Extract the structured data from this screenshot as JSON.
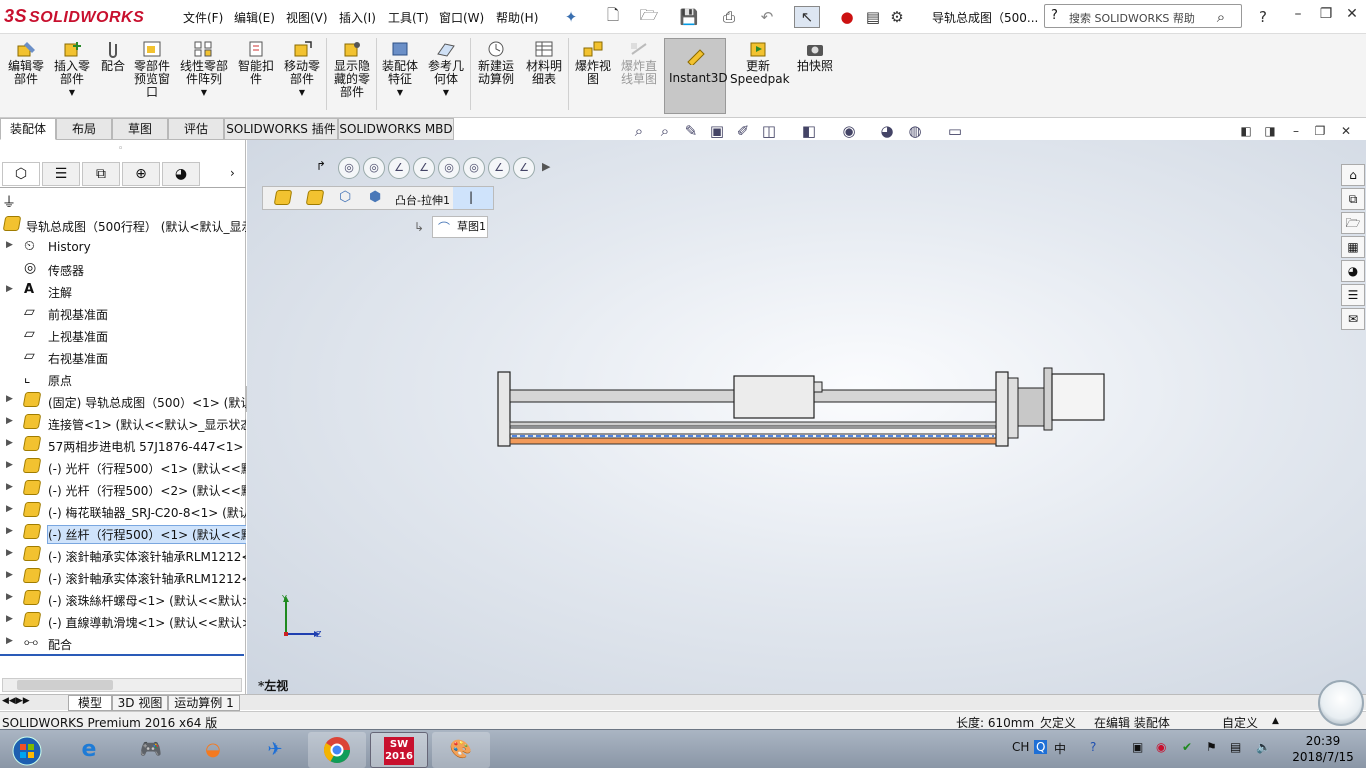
{
  "app": {
    "logo": "SOLIDWORKS",
    "logo_mark": "3S",
    "doc_title": "导轨总成图（500...",
    "search_placeholder": "搜索 SOLIDWORKS 帮助"
  },
  "menus": [
    "文件(F)",
    "编辑(E)",
    "视图(V)",
    "插入(I)",
    "工具(T)",
    "窗口(W)",
    "帮助(H)"
  ],
  "ribbon": {
    "buttons": [
      {
        "label": "编辑零\n部件"
      },
      {
        "label": "插入零\n部件"
      },
      {
        "label": "配合"
      },
      {
        "label": "零部件\n预览窗\n口"
      },
      {
        "label": "线性零部\n件阵列"
      },
      {
        "label": "智能扣\n件"
      },
      {
        "label": "移动零\n部件"
      },
      {
        "label": "显示隐\n藏的零\n部件"
      },
      {
        "label": "装配体\n特征"
      },
      {
        "label": "参考几\n何体"
      },
      {
        "label": "新建运\n动算例"
      },
      {
        "label": "材料明\n细表"
      },
      {
        "label": "爆炸视\n图"
      },
      {
        "label": "爆炸直\n线草图"
      },
      {
        "label": "Instant3D"
      },
      {
        "label": "更新\nSpeedpak"
      },
      {
        "label": "拍快照"
      }
    ]
  },
  "tabs": [
    "装配体",
    "布局",
    "草图",
    "评估",
    "SOLIDWORKS 插件",
    "SOLIDWORKS MBD"
  ],
  "tree": {
    "root": "导轨总成图（500行程）  (默认<默认_显示",
    "items": [
      {
        "label": "History"
      },
      {
        "label": "传感器"
      },
      {
        "label": "注解"
      },
      {
        "label": "前视基准面"
      },
      {
        "label": "上视基准面"
      },
      {
        "label": "右视基准面"
      },
      {
        "label": "原点"
      },
      {
        "label": "(固定) 导轨总成图（500）<1> (默认"
      },
      {
        "label": "连接管<1> (默认<<默认>_显示状态"
      },
      {
        "label": "57两相步进电机 57J1876-447<1> ("
      },
      {
        "label": "(-) 光杆（行程500）<1> (默认<<默"
      },
      {
        "label": "(-) 光杆（行程500）<2> (默认<<默"
      },
      {
        "label": "(-) 梅花联轴器_SRJ-C20-8<1> (默认"
      },
      {
        "label": "(-) 丝杆（行程500）<1> (默认<<默"
      },
      {
        "label": "(-) 滚針軸承实体滚针轴承RLM1212<"
      },
      {
        "label": "(-) 滚針軸承实体滚针轴承RLM1212<"
      },
      {
        "label": "(-) 滚珠絲杆螺母<1> (默认<<默认>"
      },
      {
        "label": "(-) 直線導軌滑塊<1> (默认<<默认>"
      },
      {
        "label": "配合"
      }
    ]
  },
  "viewport": {
    "breadcrumb": "凸台-拉伸1",
    "sketch_chip": "草图1",
    "view_label": "*左视",
    "axis_x": "Z",
    "axis_y": "Y"
  },
  "bottom_tabs": [
    "模型",
    "3D 视图",
    "运动算例 1"
  ],
  "status": {
    "product": "SOLIDWORKS Premium 2016 x64 版",
    "length": "长度: 610mm",
    "define": "欠定义",
    "mode": "在编辑 装配体",
    "custom": "自定义"
  },
  "taskbar": {
    "lang": "CH",
    "time": "20:39",
    "date": "2018/7/15",
    "ime": "中",
    "sw_badge": "2016"
  },
  "colors": {
    "accent": "#c8102e",
    "selection": "#cfe3fb"
  }
}
